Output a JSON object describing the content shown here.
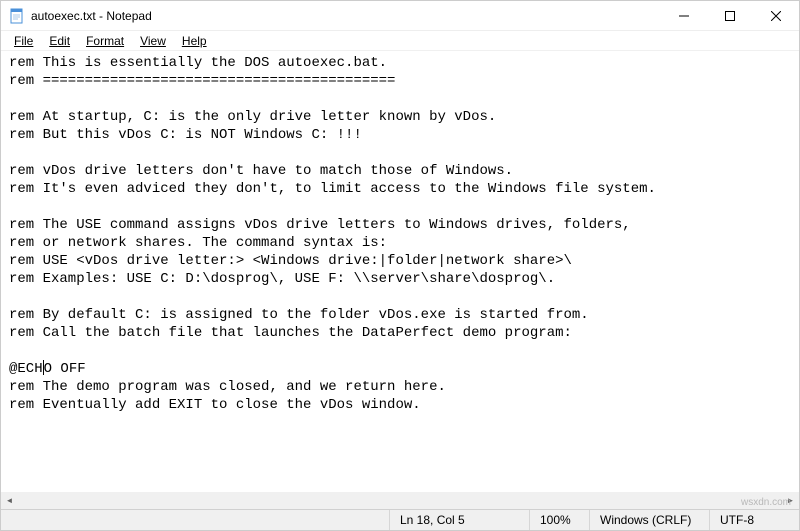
{
  "title": "autoexec.txt - Notepad",
  "menus": {
    "file": "File",
    "edit": "Edit",
    "format": "Format",
    "view": "View",
    "help": "Help"
  },
  "content": {
    "l1": "rem This is essentially the DOS autoexec.bat.",
    "l2": "rem ==========================================",
    "l3": "",
    "l4": "rem At startup, C: is the only drive letter known by vDos.",
    "l5": "rem But this vDos C: is NOT Windows C: !!!",
    "l6": "",
    "l7": "rem vDos drive letters don't have to match those of Windows.",
    "l8": "rem It's even adviced they don't, to limit access to the Windows file system.",
    "l9": "",
    "l10": "rem The USE command assigns vDos drive letters to Windows drives, folders,",
    "l11": "rem or network shares. The command syntax is:",
    "l12": "rem USE <vDos drive letter:> <Windows drive:|folder|network share>\\",
    "l13": "rem Examples: USE C: D:\\dosprog\\, USE F: \\\\server\\share\\dosprog\\.",
    "l14": "",
    "l15": "rem By default C: is assigned to the folder vDos.exe is started from.",
    "l16": "rem Call the batch file that launches the DataPerfect demo program:",
    "l17": "",
    "l18a": "@ECH",
    "l18b": "O OFF",
    "l19": "rem The demo program was closed, and we return here.",
    "l20": "rem Eventually add EXIT to close the vDos window."
  },
  "status": {
    "position": "Ln 18, Col 5",
    "zoom": "100%",
    "lineend": "Windows (CRLF)",
    "encoding": "UTF-8"
  },
  "watermark": "wsxdn.com"
}
